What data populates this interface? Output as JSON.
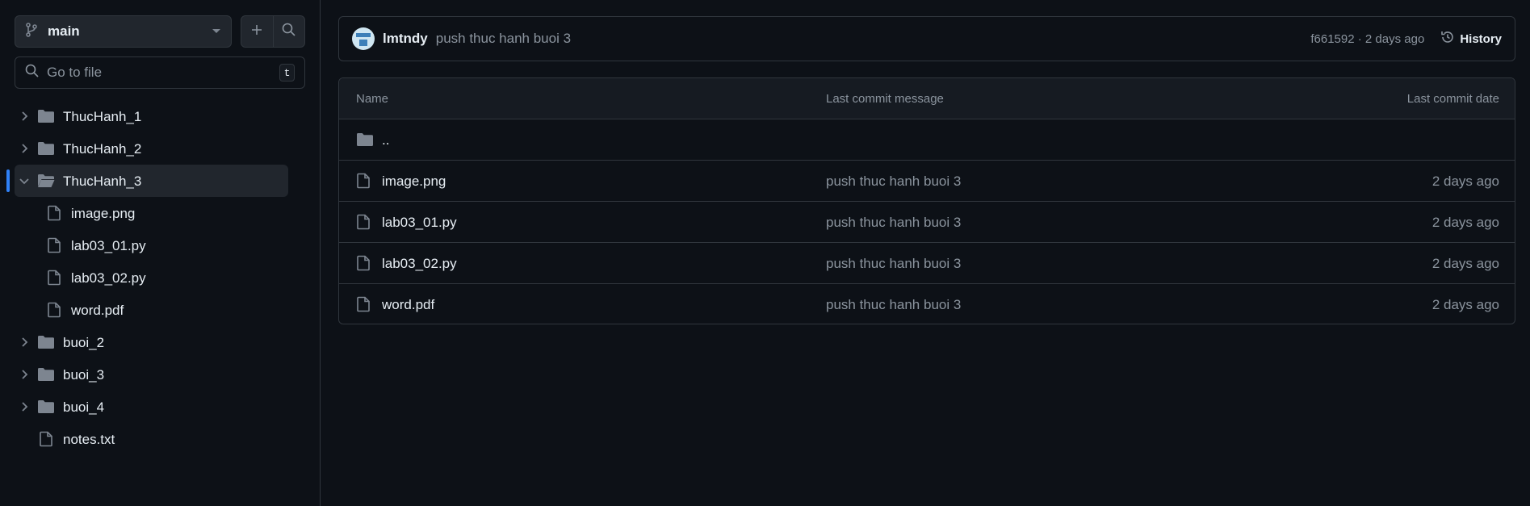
{
  "sidebar": {
    "branch": {
      "label": "main",
      "icon": "git-branch-icon"
    },
    "buttons": {
      "add_icon": "plus-icon",
      "search_icon": "search-icon"
    },
    "search": {
      "placeholder": "Go to file",
      "shortcut": "t"
    },
    "tree": [
      {
        "label": "ThucHanh_1",
        "type": "folder",
        "expanded": false
      },
      {
        "label": "ThucHanh_2",
        "type": "folder",
        "expanded": false
      },
      {
        "label": "ThucHanh_3",
        "type": "folder",
        "expanded": true,
        "selected": true
      },
      {
        "label": "image.png",
        "type": "file",
        "nested": true
      },
      {
        "label": "lab03_01.py",
        "type": "file",
        "nested": true
      },
      {
        "label": "lab03_02.py",
        "type": "file",
        "nested": true
      },
      {
        "label": "word.pdf",
        "type": "file",
        "nested": true
      },
      {
        "label": "buoi_2",
        "type": "folder",
        "expanded": false
      },
      {
        "label": "buoi_3",
        "type": "folder",
        "expanded": false
      },
      {
        "label": "buoi_4",
        "type": "folder",
        "expanded": false
      },
      {
        "label": "notes.txt",
        "type": "file",
        "nested": false
      }
    ]
  },
  "commit": {
    "author": "lmtndy",
    "message": "push thuc hanh buoi 3",
    "meta": "f661592 · 2 days ago",
    "history_label": "History"
  },
  "table": {
    "headers": {
      "name": "Name",
      "message": "Last commit message",
      "date": "Last commit date"
    },
    "parent_dir": "..",
    "rows": [
      {
        "name": "image.png",
        "message": "push thuc hanh buoi 3",
        "date": "2 days ago"
      },
      {
        "name": "lab03_01.py",
        "message": "push thuc hanh buoi 3",
        "date": "2 days ago"
      },
      {
        "name": "lab03_02.py",
        "message": "push thuc hanh buoi 3",
        "date": "2 days ago"
      },
      {
        "name": "word.pdf",
        "message": "push thuc hanh buoi 3",
        "date": "2 days ago"
      }
    ]
  },
  "colors": {
    "background": "#0d1117",
    "border": "#30363d",
    "accent": "#2f81f7",
    "muted_text": "#8b949e",
    "icon": "#7d8590"
  }
}
